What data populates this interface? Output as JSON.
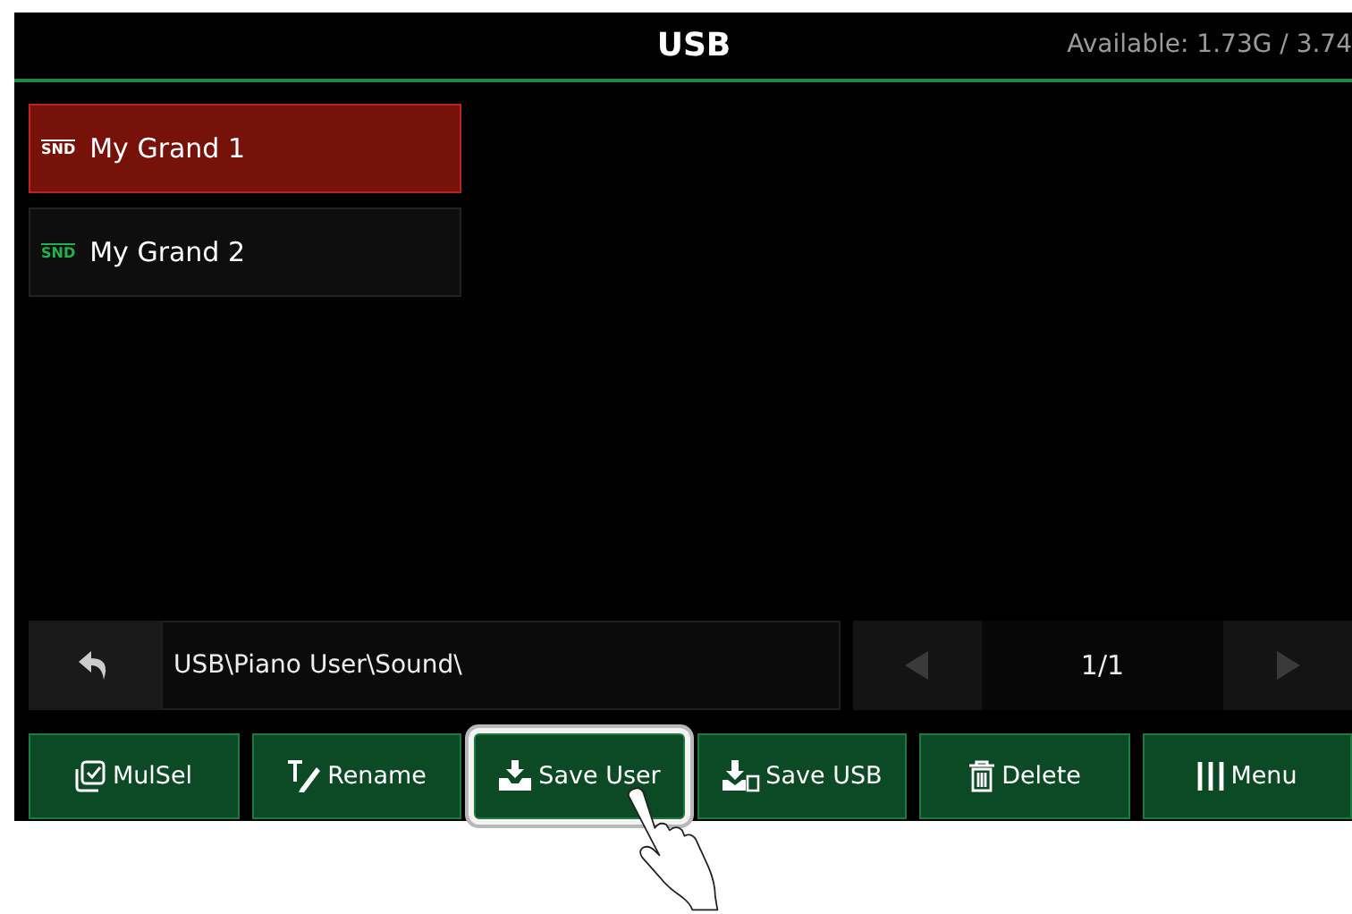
{
  "header": {
    "title": "USB",
    "storage": "Available: 1.73G / 3.74"
  },
  "files": [
    {
      "name": "My Grand 1",
      "icon_text": "SND",
      "selected": true
    },
    {
      "name": "My Grand 2",
      "icon_text": "SND",
      "selected": false
    }
  ],
  "path": "USB\\Piano User\\Sound\\",
  "pager": {
    "page": "1/1"
  },
  "buttons": [
    {
      "kind": "mulsel",
      "label": "MulSel",
      "highlighted": false
    },
    {
      "kind": "rename",
      "label": "Rename",
      "highlighted": false
    },
    {
      "kind": "saveuser",
      "label": "Save User",
      "highlighted": true
    },
    {
      "kind": "saveusb",
      "label": "Save USB",
      "highlighted": false
    },
    {
      "kind": "delete",
      "label": "Delete",
      "highlighted": false
    },
    {
      "kind": "menu",
      "label": "Menu",
      "highlighted": false
    }
  ]
}
